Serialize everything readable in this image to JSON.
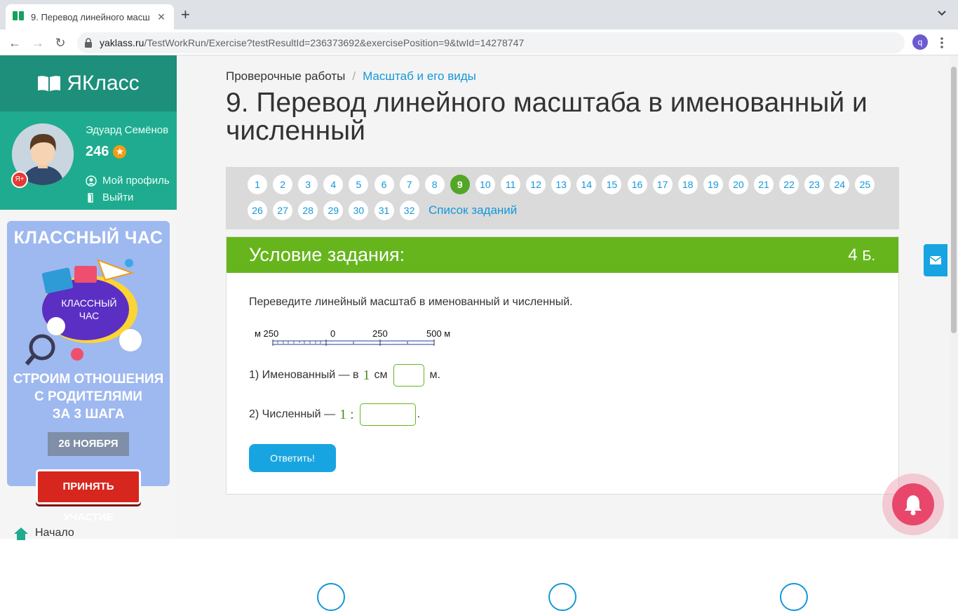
{
  "browser": {
    "tab_title": "9. Перевод линейного масшт",
    "url_host": "yaklass.ru",
    "url_path": "/TestWorkRun/Exercise?testResultId=236373692&exercisePosition=9&twId=14278747",
    "profile_initial": "q"
  },
  "sidebar": {
    "brand": "ЯКласс",
    "user_name": "Эдуард Семёнов",
    "points": "246",
    "profile_link": "Мой профиль",
    "logout_link": "Выйти",
    "banner": {
      "title": "КЛАССНЫЙ ЧАС",
      "center_text": "КЛАССНЫЙ ЧАС",
      "sub_line1": "СТРОИМ ОТНОШЕНИЯ",
      "sub_line2": "С РОДИТЕЛЯМИ",
      "sub_line3": "ЗА 3 ШАГА",
      "date": "26 НОЯБРЯ",
      "cta": "ПРИНЯТЬ УЧАСТИЕ"
    },
    "start_link": "Начало"
  },
  "breadcrumb": {
    "root": "Проверочные работы",
    "current": "Масштаб и его виды"
  },
  "page_title": "9. Перевод линейного масштаба в именованный и численный",
  "pager": {
    "row1": [
      "1",
      "2",
      "3",
      "4",
      "5",
      "6",
      "7",
      "8",
      "9",
      "10",
      "11",
      "12",
      "13",
      "14",
      "15",
      "16",
      "17",
      "18",
      "19",
      "20",
      "21",
      "22",
      "23",
      "24",
      "25"
    ],
    "row2": [
      "26",
      "27",
      "28",
      "29",
      "30",
      "31",
      "32"
    ],
    "active": "9",
    "task_list": "Список заданий"
  },
  "task": {
    "header": "Условие задания:",
    "points_value": "4",
    "points_unit": "Б.",
    "text": "Переведите линейный масштаб в именованный и численный.",
    "scale_labels": [
      "м 250",
      "0",
      "250",
      "500 м"
    ],
    "q1_prefix": "1) Именованный — в",
    "q1_num": "1",
    "q1_unit": "см",
    "q1_suffix": "м.",
    "q1_value": "",
    "q2_prefix": "2) Численный —",
    "q2_num": "1 :",
    "q2_suffix": ".",
    "q2_value": "",
    "submit": "Ответить!"
  },
  "colors": {
    "brand_dark": "#1d8f7a",
    "brand": "#1fab8f",
    "task_header": "#66b51d",
    "link": "#1597d8",
    "button": "#18a4e0"
  }
}
